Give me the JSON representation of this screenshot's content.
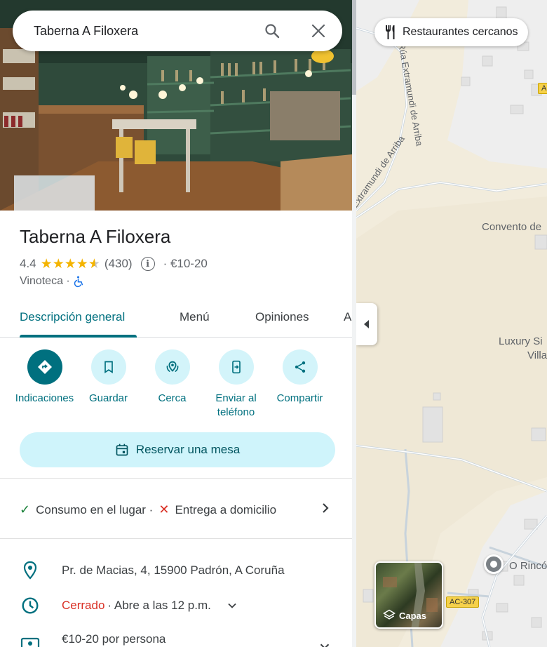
{
  "search": {
    "value": "Taberna A Filoxera"
  },
  "place": {
    "name": "Taberna A Filoxera",
    "rating": "4.4",
    "stars_value": 4.4,
    "reviews": "(430)",
    "price": "· €10-20",
    "category": "Vinoteca ·"
  },
  "tabs": [
    {
      "label": "Descripción general"
    },
    {
      "label": "Menú"
    },
    {
      "label": "Opiniones"
    },
    {
      "label": "A"
    }
  ],
  "actions": [
    {
      "label": "Indicaciones",
      "icon": "directions-icon"
    },
    {
      "label": "Guardar",
      "icon": "bookmark-icon"
    },
    {
      "label": "Cerca",
      "icon": "nearby-icon"
    },
    {
      "label": "Enviar al teléfono",
      "icon": "send-to-phone-icon"
    },
    {
      "label": "Compartir",
      "icon": "share-icon"
    }
  ],
  "reserve": {
    "label": "Reservar una mesa"
  },
  "services": {
    "dine_in": "Consumo en el lugar ·",
    "delivery": "Entrega a domicilio"
  },
  "info": {
    "address": "Pr. de Macias, 4, 15900 Padrón, A Coruña",
    "status": "Cerrado",
    "hours": "· Abre a las 12 p.m.",
    "price_per_person": "€10-20 por persona"
  },
  "map": {
    "chip": "Restaurantes cercanos",
    "layers": "Capas",
    "labels": {
      "street1": "Rúa Extramundi de Arriba",
      "street2": "Extramundi de Arriba",
      "convento": "Convento de",
      "luxury1": "Luxury Si",
      "luxury2": "Villa",
      "rincon": "O Rincó"
    },
    "road_badge": "AC-307",
    "road_badge_small": "A"
  },
  "colors": {
    "accent": "#00707f",
    "accent_light": "#d3f4fa",
    "closed": "#d93025",
    "check": "#188038"
  }
}
